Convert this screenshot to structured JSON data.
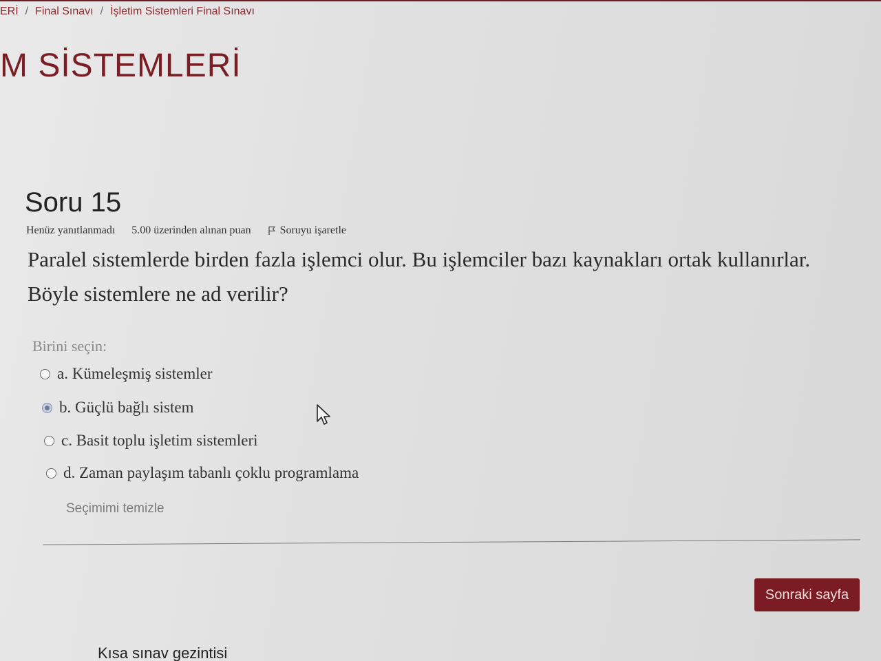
{
  "breadcrumb": {
    "items": [
      "ERİ",
      "Final Sınavı",
      "İşletim Sistemleri Final Sınavı"
    ],
    "separator": "/"
  },
  "course": {
    "title_visible": "M SİSTEMLERİ"
  },
  "question": {
    "title": "Soru 15",
    "status": "Henüz yanıtlanmadı",
    "points": "5.00 üzerinden alınan puan",
    "flag_label": "Soruyu işaretle",
    "text_line1": "Paralel sistemlerde birden fazla işlemci olur. Bu işlemciler bazı kaynakları ortak kullanırlar.",
    "text_line2": "Böyle sistemlere ne ad verilir?",
    "prompt": "Birini seçin:",
    "answers": [
      {
        "label": "a. Kümeleşmiş sistemler",
        "selected": false
      },
      {
        "label": "b. Güçlü bağlı sistem",
        "selected": true
      },
      {
        "label": "c. Basit toplu işletim sistemleri",
        "selected": false
      },
      {
        "label": "d. Zaman paylaşım tabanlı çoklu programlama",
        "selected": false
      }
    ],
    "clear_label": "Seçimimi temizle"
  },
  "navigation": {
    "next_label": "Sonraki sayfa",
    "quiz_nav_label": "Kısa sınav gezintisi"
  },
  "colors": {
    "brand": "#7b1b23",
    "background": "#e4e4e4"
  },
  "icons": {
    "flag": "flag-icon",
    "cursor": "mouse-pointer-icon"
  }
}
